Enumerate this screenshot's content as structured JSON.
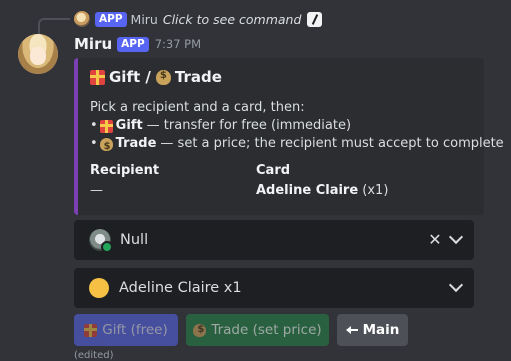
{
  "reply": {
    "app_badge": "APP",
    "author": "Miru",
    "command_text": "Click to see command"
  },
  "header": {
    "author": "Miru",
    "app_badge": "APP",
    "timestamp": "7:37 PM"
  },
  "embed": {
    "accent_color": "#7b3fb6",
    "title_gift": "Gift /",
    "title_trade": "Trade",
    "description_intro": "Pick a recipient and a card, then:",
    "gift_label": "Gift",
    "gift_desc": "— transfer for free (immediate)",
    "trade_label": "Trade",
    "trade_desc": "— set a price; the recipient must accept to complete",
    "bullet": "•",
    "fields": [
      {
        "name": "Recipient",
        "value": "—"
      },
      {
        "name": "Card",
        "value_bold": "Adeline Claire",
        "value_suffix": " (x1)"
      }
    ]
  },
  "selects": {
    "recipient": {
      "value": "Null",
      "clear_icon": "close-icon",
      "chevron_icon": "chevron-down-icon"
    },
    "card": {
      "value": "Adeline Claire x1",
      "chevron_icon": "chevron-down-icon"
    }
  },
  "buttons": {
    "gift": "Gift (free)",
    "trade": "Trade (set price)",
    "main": "Main"
  },
  "footer": {
    "edited": "(edited)"
  }
}
